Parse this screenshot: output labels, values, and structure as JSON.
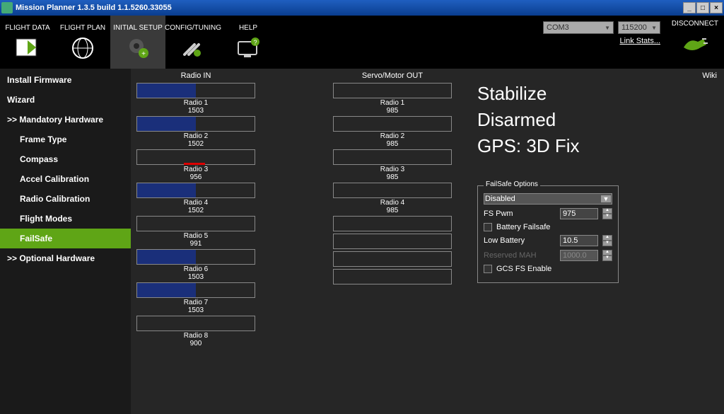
{
  "title": "Mission Planner 1.3.5 build 1.1.5260.33055",
  "tabs": [
    {
      "label": "FLIGHT DATA"
    },
    {
      "label": "FLIGHT PLAN"
    },
    {
      "label": "INITIAL SETUP"
    },
    {
      "label": "CONFIG/TUNING"
    },
    {
      "label": "HELP"
    }
  ],
  "port_combo": "COM3",
  "baud_combo": "115200",
  "link_stats": "Link Stats...",
  "disconnect": "DISCONNECT",
  "sidebar": {
    "items": [
      {
        "label": "Install Firmware"
      },
      {
        "label": "Wizard"
      },
      {
        "label": ">> Mandatory Hardware"
      },
      {
        "label": "Frame Type"
      },
      {
        "label": "Compass"
      },
      {
        "label": "Accel Calibration"
      },
      {
        "label": "Radio Calibration"
      },
      {
        "label": "Flight Modes"
      },
      {
        "label": "FailSafe"
      },
      {
        "label": ">> Optional Hardware"
      }
    ]
  },
  "wiki": "Wiki",
  "radio_in_header": "Radio IN",
  "servo_out_header": "Servo/Motor OUT",
  "radio_in": [
    {
      "label": "Radio 1",
      "value": "1503",
      "pct": 50
    },
    {
      "label": "Radio 2",
      "value": "1502",
      "pct": 50
    },
    {
      "label": "Radio 3",
      "value": "956",
      "pct": 0
    },
    {
      "label": "Radio 4",
      "value": "1502",
      "pct": 50
    },
    {
      "label": "Radio 5",
      "value": "991",
      "pct": 0
    },
    {
      "label": "Radio 6",
      "value": "1503",
      "pct": 50
    },
    {
      "label": "Radio 7",
      "value": "1503",
      "pct": 50
    },
    {
      "label": "Radio 8",
      "value": "900",
      "pct": 0
    }
  ],
  "servo_out": [
    {
      "label": "Radio 1",
      "value": "985"
    },
    {
      "label": "Radio 2",
      "value": "985"
    },
    {
      "label": "Radio 3",
      "value": "985"
    },
    {
      "label": "Radio 4",
      "value": "985"
    },
    {
      "label": "",
      "value": ""
    },
    {
      "label": "",
      "value": ""
    },
    {
      "label": "",
      "value": ""
    },
    {
      "label": "",
      "value": ""
    }
  ],
  "status": {
    "mode": "Stabilize",
    "arm": "Disarmed",
    "gps": "GPS: 3D Fix"
  },
  "failsafe": {
    "legend": "FailSafe Options",
    "mode": "Disabled",
    "fs_pwm_label": "FS Pwm",
    "fs_pwm": "975",
    "battery_fs_label": "Battery Failsafe",
    "low_battery_label": "Low Battery",
    "low_battery": "10.5",
    "reserved_label": "Reserved MAH",
    "reserved": "1000.0",
    "gcs_fs_label": "GCS FS Enable"
  }
}
